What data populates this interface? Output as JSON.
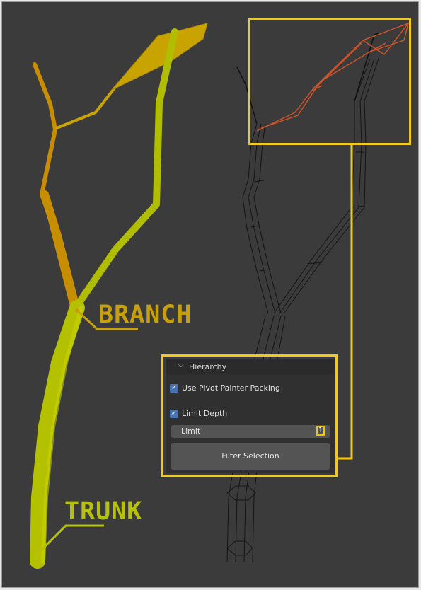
{
  "annotations": {
    "branch_label": "BRANCH",
    "trunk_label": "TRUNK"
  },
  "panel": {
    "header_title": "Hierarchy",
    "use_pivot_painter_packing": {
      "label": "Use Pivot Painter Packing",
      "checked": true
    },
    "limit_depth": {
      "label": "Limit Depth",
      "checked": true
    },
    "limit": {
      "label": "Limit",
      "value": "1"
    },
    "filter_button_label": "Filter Selection"
  },
  "colors": {
    "viewport_background": "#3b3b3b",
    "trunk_yellow_green": "#b9c700",
    "branch_yellow": "#d6a600",
    "highlight_frame": "#f2c81d",
    "wireframe_selected": "#d2542a",
    "checkbox_blue": "#4772b3"
  }
}
